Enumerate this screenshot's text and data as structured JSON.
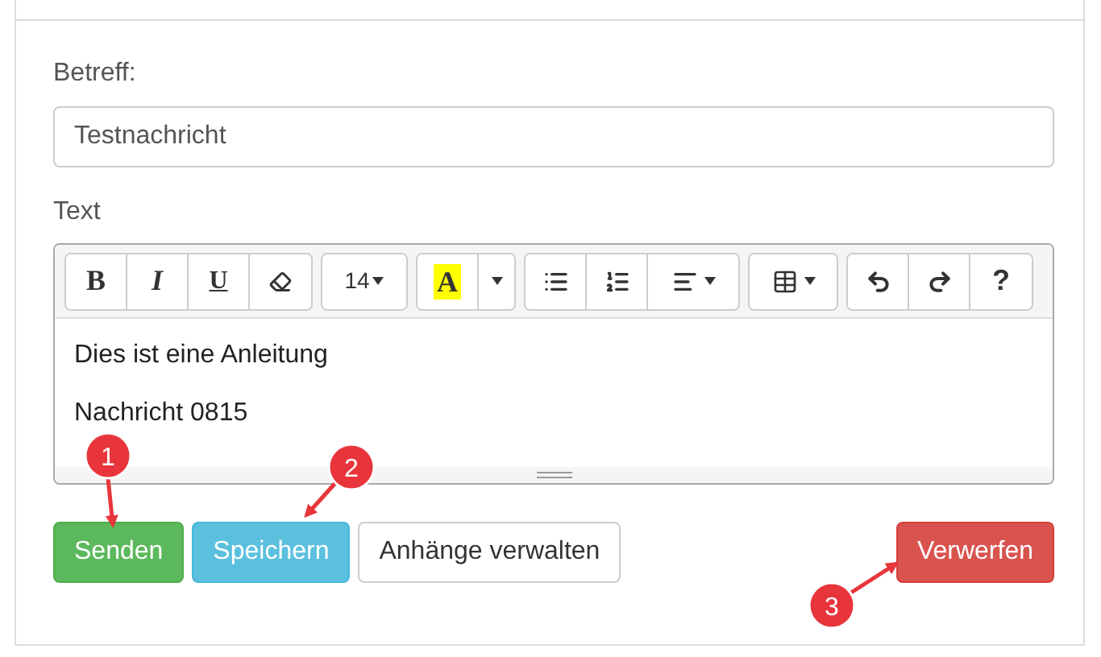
{
  "subject": {
    "label": "Betreff:",
    "value": "Testnachricht"
  },
  "editor": {
    "label": "Text",
    "toolbar": [
      [
        {
          "kind": "bold",
          "text": "B"
        },
        {
          "kind": "italic",
          "text": "I"
        },
        {
          "kind": "underline",
          "text": "U"
        },
        {
          "kind": "eraser"
        }
      ],
      [
        {
          "kind": "fontsize",
          "text": "14"
        }
      ],
      [
        {
          "kind": "highlight",
          "text": "A"
        },
        {
          "kind": "caret"
        }
      ],
      [
        {
          "kind": "bullets"
        },
        {
          "kind": "numbered"
        },
        {
          "kind": "align"
        }
      ],
      [
        {
          "kind": "table"
        }
      ],
      [
        {
          "kind": "undo"
        },
        {
          "kind": "redo"
        },
        {
          "kind": "help",
          "text": "?"
        }
      ]
    ],
    "lines": [
      "Dies ist eine Anleitung",
      "Nachricht 0815"
    ]
  },
  "buttons": [
    {
      "label": "Senden",
      "kind": "success"
    },
    {
      "label": "Speichern",
      "kind": "info"
    },
    {
      "label": "Anhänge verwalten",
      "kind": "default"
    },
    {
      "label": "Verwerfen",
      "kind": "danger"
    }
  ],
  "callouts": [
    {
      "number": "1"
    },
    {
      "number": "2"
    },
    {
      "number": "3"
    }
  ]
}
